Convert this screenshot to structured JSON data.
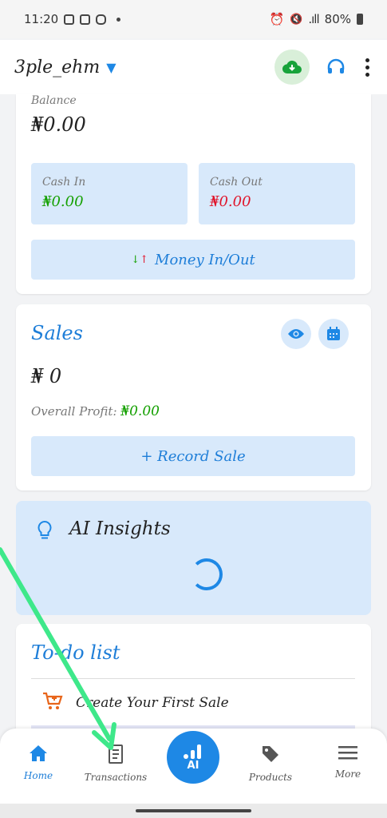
{
  "status_bar": {
    "time": "11:20",
    "battery": "80%"
  },
  "app_bar": {
    "store_name": "3ple_ehm"
  },
  "balance_card": {
    "balance_label": "Balance",
    "balance_value": "₦0.00",
    "cash_in_label": "Cash In",
    "cash_in_value": "₦0.00",
    "cash_out_label": "Cash Out",
    "cash_out_value": "₦0.00",
    "money_button_label": "Money In/Out"
  },
  "sales_card": {
    "title": "Sales",
    "amount": "₦ 0",
    "profit_label": "Overall Profit:",
    "profit_value": "₦0.00",
    "record_button_label": "+ Record Sale"
  },
  "ai_card": {
    "title": "AI Insights"
  },
  "todo_card": {
    "title": "To-do list",
    "items": [
      {
        "label": "Create Your First Sale"
      }
    ]
  },
  "bottom_nav": {
    "items": [
      {
        "label": "Home"
      },
      {
        "label": "Transactions"
      },
      {
        "label": "AI"
      },
      {
        "label": "Products"
      },
      {
        "label": "More"
      }
    ]
  },
  "colors": {
    "accent": "#1e88e5",
    "cash_in": "#14a000",
    "cash_out": "#e0142a",
    "panel": "#d8e9fb",
    "annotation_arrow": "#3ee88a"
  },
  "icons": [
    "cloud-download-icon",
    "headset-icon",
    "more-vert-icon",
    "arrows-updown-icon",
    "eye-icon",
    "calendar-icon",
    "lightbulb-icon",
    "cart-icon",
    "home-icon",
    "receipt-icon",
    "chart-icon",
    "tag-icon",
    "menu-icon"
  ]
}
